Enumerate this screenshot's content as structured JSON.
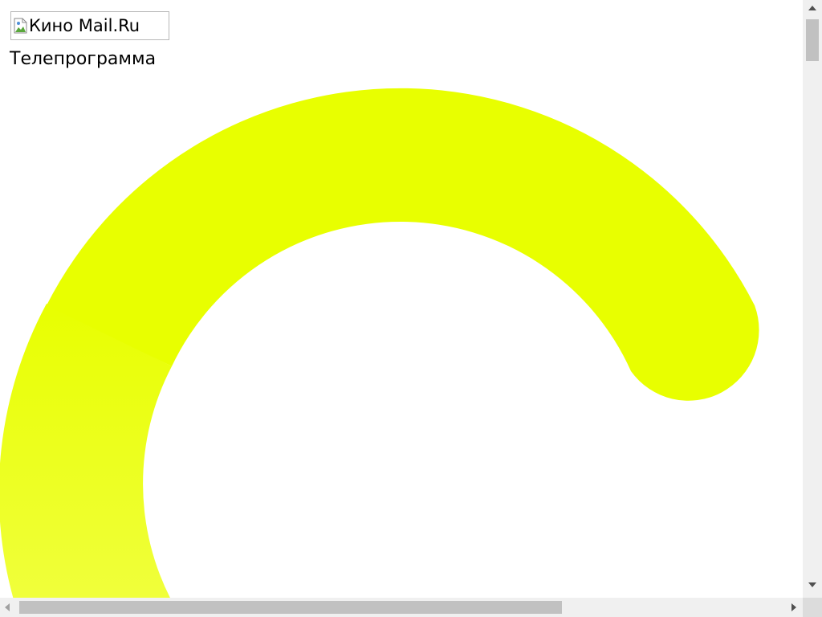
{
  "logo": {
    "alt_text": "Кино Mail.Ru"
  },
  "page": {
    "section_title": "Телепрограмма"
  },
  "loader": {
    "color": "#e8ff00",
    "color_fade": "#f0ff3c",
    "icon": "loading-spinner-icon"
  },
  "scrollbars": {
    "vertical": "vertical-scrollbar",
    "horizontal": "horizontal-scrollbar"
  }
}
